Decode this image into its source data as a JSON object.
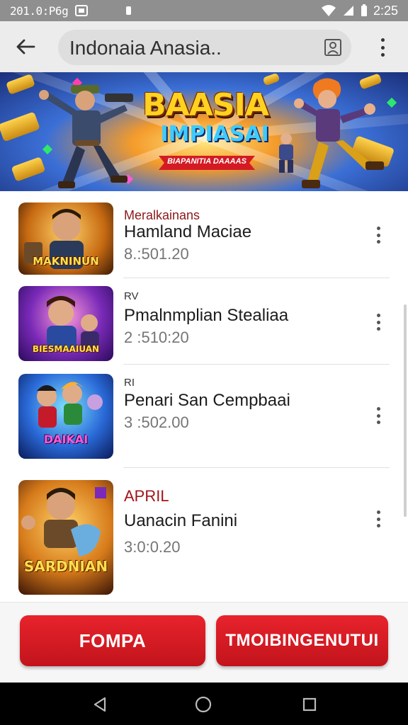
{
  "status_bar": {
    "left_time": "201.0:P6g",
    "right_time": "2:25",
    "icons": [
      "notification-box-icon",
      "battery-dot-icon",
      "wifi-icon",
      "signal-icon",
      "battery-icon"
    ]
  },
  "search": {
    "query": "Indonaia Anasia..",
    "back_icon": "arrow-left-icon",
    "image_search_icon": "image-search-icon",
    "more_icon": "more-vertical-icon"
  },
  "banner": {
    "title": "BAASIA",
    "subtitle": "IMPIASAI",
    "ribbon": "BIAPANITIA DAAAAS"
  },
  "list": {
    "items": [
      {
        "tag": "Meralkainans",
        "title": "Hamland Maciae",
        "meta": "8.:501.20",
        "thumb_caption": "MAKNINUN"
      },
      {
        "tag": "RV",
        "title": "Pmalnmplian Stealiaa",
        "meta": "2 :510:20",
        "thumb_caption": "BIESMAAIUAN"
      },
      {
        "tag": "RI",
        "title": "Penari San Cempbaai",
        "meta": "3 :502.00",
        "thumb_caption": "DAIKAI"
      },
      {
        "tag": "APRIL",
        "title": "Uanacin Fanini",
        "meta": "3:0:0.20",
        "thumb_caption": "SARDNIAN"
      }
    ]
  },
  "buttons": {
    "left_label": "FOMPA",
    "right_label": "TMOIBINGENUTUI"
  },
  "nav": {
    "back": "nav-back-icon",
    "home": "nav-home-icon",
    "recents": "nav-recents-icon"
  },
  "colors": {
    "accent_red": "#d41b23",
    "tag_red": "#8b1a1a",
    "status_bar": "#8f8f8f"
  }
}
